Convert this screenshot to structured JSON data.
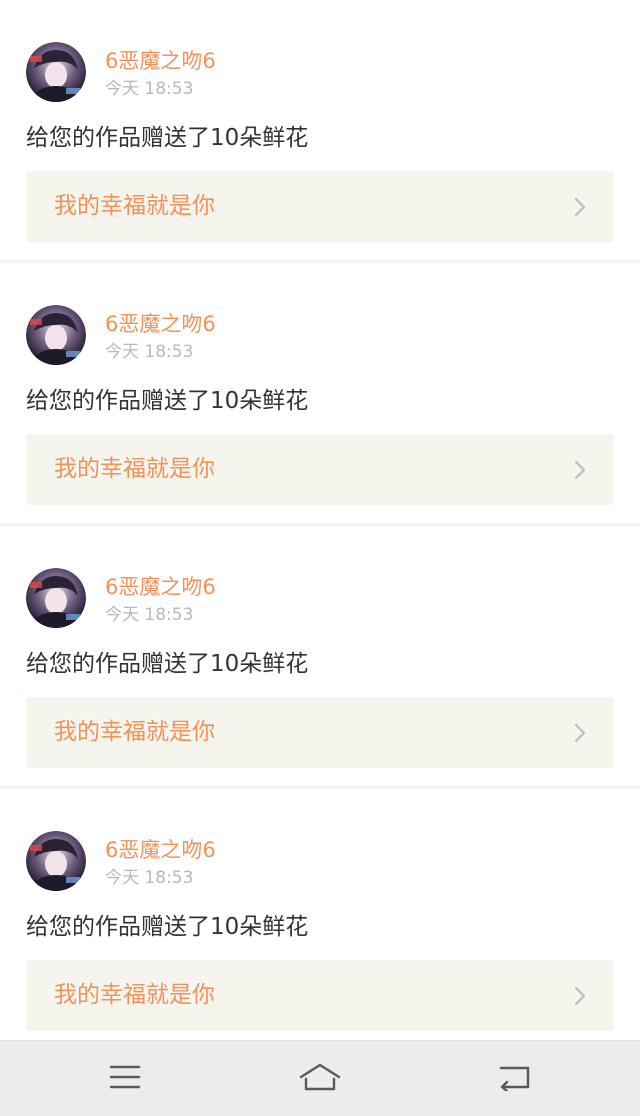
{
  "notifications": [
    {
      "user": "6恶魔之吻6",
      "time": "今天 18:53",
      "message": "给您的作品赠送了10朵鲜花",
      "work_title": "我的幸福就是你"
    },
    {
      "user": "6恶魔之吻6",
      "time": "今天 18:53",
      "message": "给您的作品赠送了10朵鲜花",
      "work_title": "我的幸福就是你"
    },
    {
      "user": "6恶魔之吻6",
      "time": "今天 18:53",
      "message": "给您的作品赠送了10朵鲜花",
      "work_title": "我的幸福就是你"
    },
    {
      "user": "6恶魔之吻6",
      "time": "今天 18:53",
      "message": "给您的作品赠送了10朵鲜花",
      "work_title": "我的幸福就是你"
    }
  ],
  "colors": {
    "accent_orange": "#f0935b",
    "tab_indicator": "#ee6fa5",
    "link_background": "#f5f5ee",
    "separator": "#f4f4f4",
    "navbar": "#ececec"
  },
  "navbar": {
    "icons": [
      "menu-icon",
      "home-icon",
      "back-icon"
    ]
  }
}
